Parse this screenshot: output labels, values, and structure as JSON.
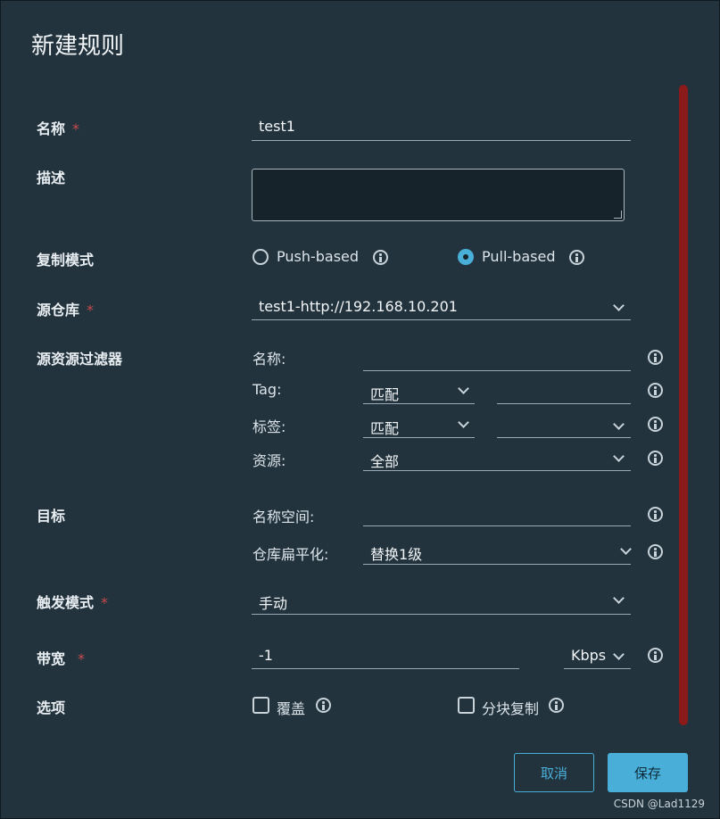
{
  "dialog": {
    "title": "新建规则"
  },
  "form": {
    "name": {
      "label": "名称",
      "required": "*",
      "value": "test1"
    },
    "description": {
      "label": "描述",
      "value": ""
    },
    "replication_mode": {
      "label": "复制模式",
      "options": [
        {
          "label": "Push-based",
          "selected": false
        },
        {
          "label": "Pull-based",
          "selected": true
        }
      ]
    },
    "source_registry": {
      "label": "源仓库",
      "required": "*",
      "value": "test1-http://192.168.10.201"
    },
    "source_filter": {
      "label": "源资源过滤器",
      "name": {
        "label": "名称:",
        "value": ""
      },
      "tag": {
        "label": "Tag:",
        "match": "匹配",
        "value": ""
      },
      "tag_label": {
        "label": "标签:",
        "match": "匹配",
        "value": ""
      },
      "resource": {
        "label": "资源:",
        "value": "全部"
      }
    },
    "destination": {
      "label": "目标",
      "namespace": {
        "label": "名称空间:",
        "value": ""
      },
      "flattening": {
        "label": "仓库扁平化:",
        "value": "替换1级"
      }
    },
    "trigger_mode": {
      "label": "触发模式",
      "required": "*",
      "value": "手动"
    },
    "bandwidth": {
      "label": "带宽",
      "required": "*",
      "value": "-1",
      "unit": "Kbps"
    },
    "options": {
      "label": "选项",
      "override": {
        "label": "覆盖",
        "checked": false
      },
      "chunked": {
        "label": "分块复制",
        "checked": false
      }
    }
  },
  "buttons": {
    "cancel": "取消",
    "save": "保存"
  },
  "watermark": "CSDN @Lad1129",
  "colors": {
    "background": "#22333d",
    "accent": "#49afd9",
    "required": "#c84a4a",
    "scrollbar": "#8b1a1a"
  }
}
